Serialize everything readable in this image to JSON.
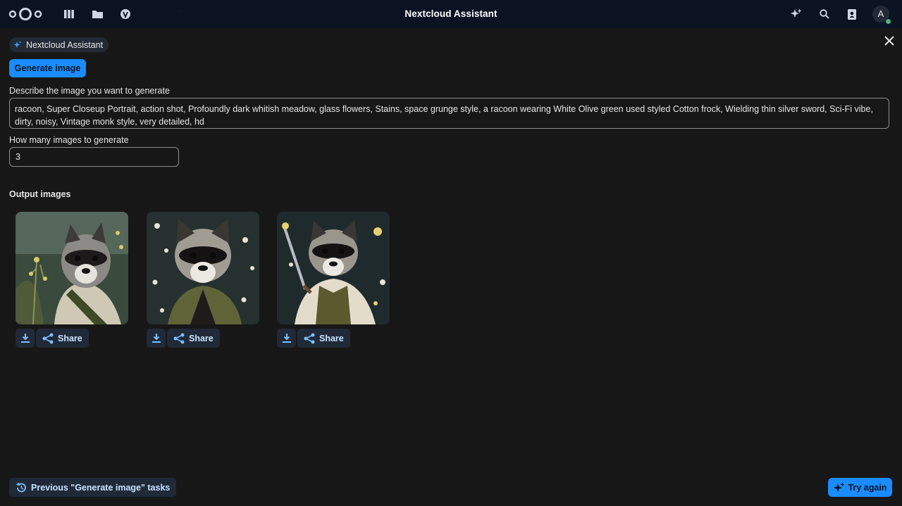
{
  "header": {
    "title": "Nextcloud Assistant",
    "avatar_initial": "A",
    "icons": [
      "nextcloud-logo",
      "dashboard-icon",
      "files-icon",
      "activity-icon",
      "assistant-icon",
      "search-icon",
      "contacts-icon"
    ]
  },
  "chip": {
    "label": "Nextcloud Assistant"
  },
  "task_button": {
    "label": "Generate image"
  },
  "prompt": {
    "label": "Describe the image you want to generate",
    "value": "racoon, Super Closeup Portrait, action shot, Profoundly dark whitish meadow, glass flowers, Stains, space grunge style, a racoon wearing White Olive green used styled Cotton frock, Wielding thin silver sword, Sci-Fi vibe, dirty, noisy, Vintage monk style, very detailed, hd"
  },
  "count": {
    "label": "How many images to generate",
    "value": "3"
  },
  "output": {
    "title": "Output images",
    "share_label": "Share",
    "images": [
      {
        "alt": "raccoon with flowers"
      },
      {
        "alt": "raccoon in meadow"
      },
      {
        "alt": "raccoon with sword"
      }
    ]
  },
  "footer": {
    "previous_label": "Previous \"Generate image\" tasks",
    "try_again_label": "Try again"
  },
  "colors": {
    "accent": "#1a8cff",
    "header_bg": "#0b1323",
    "page_bg": "#171717"
  }
}
